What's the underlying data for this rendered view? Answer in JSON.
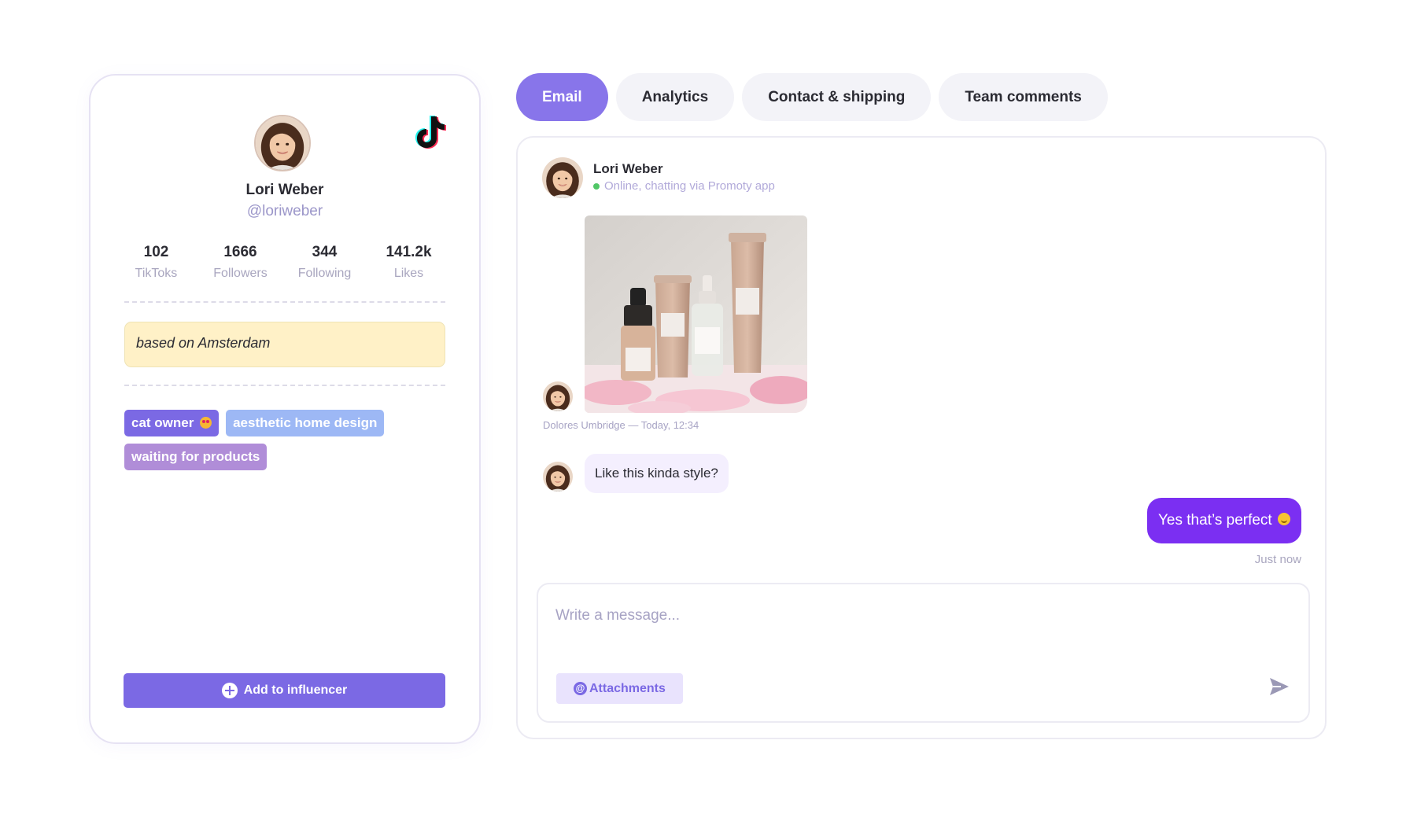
{
  "profile": {
    "name": "Lori Weber",
    "handle": "@loriweber",
    "platform_icon": "tiktok-icon",
    "stats": [
      {
        "value": "102",
        "label": "TikToks"
      },
      {
        "value": "1666",
        "label": "Followers"
      },
      {
        "value": "344",
        "label": "Following"
      },
      {
        "value": "141.2k",
        "label": "Likes"
      }
    ],
    "note": "based on Amsterdam",
    "tags": [
      {
        "label": "cat owner",
        "color": "#7b69e4",
        "emoji": "heart-eyes-emoji"
      },
      {
        "label": "aesthetic home design",
        "color": "#9db8f5"
      },
      {
        "label": "waiting for products",
        "color": "#b08dd8"
      }
    ],
    "add_button_label": "Add to influencer"
  },
  "tabs": [
    {
      "label": "Email",
      "active": true
    },
    {
      "label": "Analytics",
      "active": false
    },
    {
      "label": "Contact & shipping",
      "active": false
    },
    {
      "label": "Team comments",
      "active": false
    }
  ],
  "chat": {
    "contact_name": "Lori Weber",
    "status": "Online, chatting via Promoty app",
    "image_message_meta": "Dolores Umbridge  —  Today, 12:34",
    "incoming_message": "Like this kinda style?",
    "outgoing_message": "Yes that’s perfect",
    "outgoing_time": "Just now",
    "composer_placeholder": "Write a message...",
    "attachments_label": "Attachments"
  },
  "colors": {
    "accent": "#7b69e4",
    "tab_active": "#8875ea",
    "outgoing_bubble": "#7b2ff2",
    "incoming_bubble": "#f4effe",
    "note_bg": "#fff1c7",
    "online": "#51c767"
  }
}
